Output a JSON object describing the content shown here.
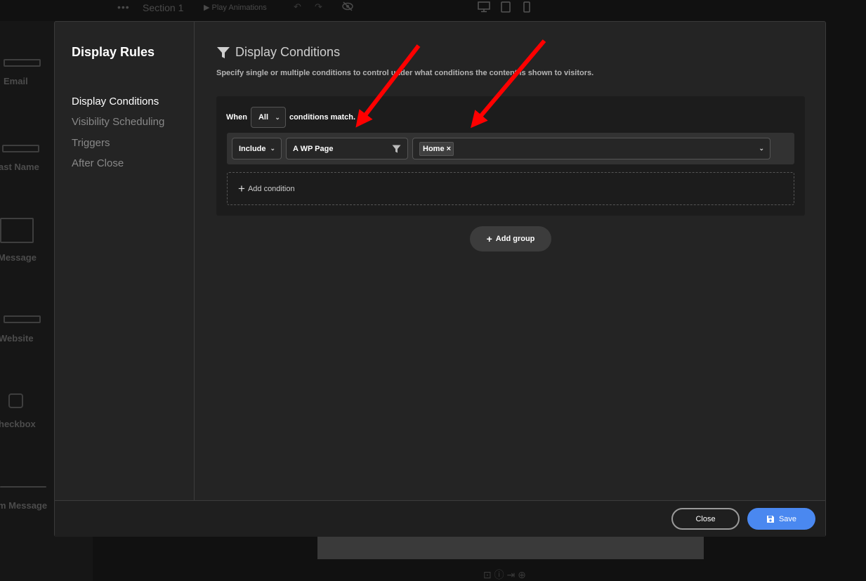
{
  "background": {
    "toolbar": {
      "section_label": "Section 1",
      "play_label": "▶ Play Animations"
    },
    "fields": [
      {
        "label": "Email"
      },
      {
        "label": "ast Name"
      },
      {
        "label": "Message"
      },
      {
        "label": "Website"
      },
      {
        "label": "heckbox"
      },
      {
        "label": "m Message"
      }
    ]
  },
  "modal": {
    "title": "Display Rules",
    "nav": [
      {
        "label": "Display Conditions",
        "active": true
      },
      {
        "label": "Visibility Scheduling",
        "active": false
      },
      {
        "label": "Triggers",
        "active": false
      },
      {
        "label": "After Close",
        "active": false
      }
    ],
    "heading": "Display Conditions",
    "description": "Specify single or multiple conditions to control under what conditions the content is shown to visitors.",
    "group": {
      "when_label": "When",
      "match_value": "All",
      "match_suffix": "conditions match.",
      "condition": {
        "include_value": "Include",
        "type_value": "A WP Page",
        "tags": [
          "Home"
        ]
      },
      "add_condition_label": "Add condition"
    },
    "add_group_label": "Add group",
    "footer": {
      "close_label": "Close",
      "save_label": "Save"
    }
  },
  "colors": {
    "accent": "#4a88f0",
    "annotation_arrow": "#ff0000"
  }
}
